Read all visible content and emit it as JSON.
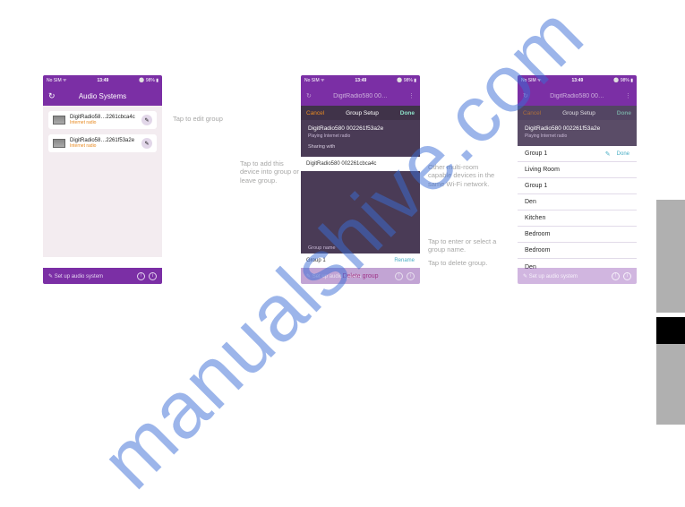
{
  "watermark": "manualshive.com",
  "statusbar": {
    "left": "No SIM ᯤ",
    "time": "13:49",
    "right": "⚪ 98% ▮"
  },
  "phone1": {
    "headerTitle": "Audio Systems",
    "devices": [
      {
        "name": "DigitRadio58…2261cbca4c",
        "sub": "Internet radio"
      },
      {
        "name": "DigitRadio58…2261f53a2e",
        "sub": "Internet radio"
      }
    ],
    "footer": "✎ Set up audio system"
  },
  "phone2": {
    "headerTitle": "DigitRadio580 00…",
    "setup": {
      "cancel": "Cancel",
      "title": "Group Setup",
      "done": "Done"
    },
    "current": {
      "name": "DigitRadio580 002261f53a2e",
      "playing": "Playing Internet radio",
      "sharing": "Sharing with"
    },
    "shareDevice": "DigitRadio580 002261cbca4c",
    "groupSection": "Group name",
    "groupName": "Group 1",
    "renameLabel": "Rename",
    "deleteLabel": "Delete group",
    "footer": "✎ Set up audio system"
  },
  "phone3": {
    "headerTitle": "DigitRadio580 00…",
    "setup": {
      "cancel": "Cancel",
      "title": "Group Setup",
      "done": "Done"
    },
    "current": {
      "name": "DigitRadio580 002261f53a2e",
      "playing": "Playing Internet radio"
    },
    "doneLabel": "Done",
    "rooms": [
      "Group 1",
      "Living Room",
      "Group 1",
      "Den",
      "Kitchen",
      "Bedroom",
      "Bedroom",
      "Den"
    ],
    "footer": "✎ Set up audio system"
  },
  "annot": {
    "editGroup": "Tap to edit group",
    "addDevice": "Tap to add this device into group or leave group.",
    "otherDevices": "Other multi-room capable devices in the same Wi-Fi network.",
    "enterName": "Tap to enter or select a group name.",
    "deleteGroup": "Tap to delete group."
  }
}
